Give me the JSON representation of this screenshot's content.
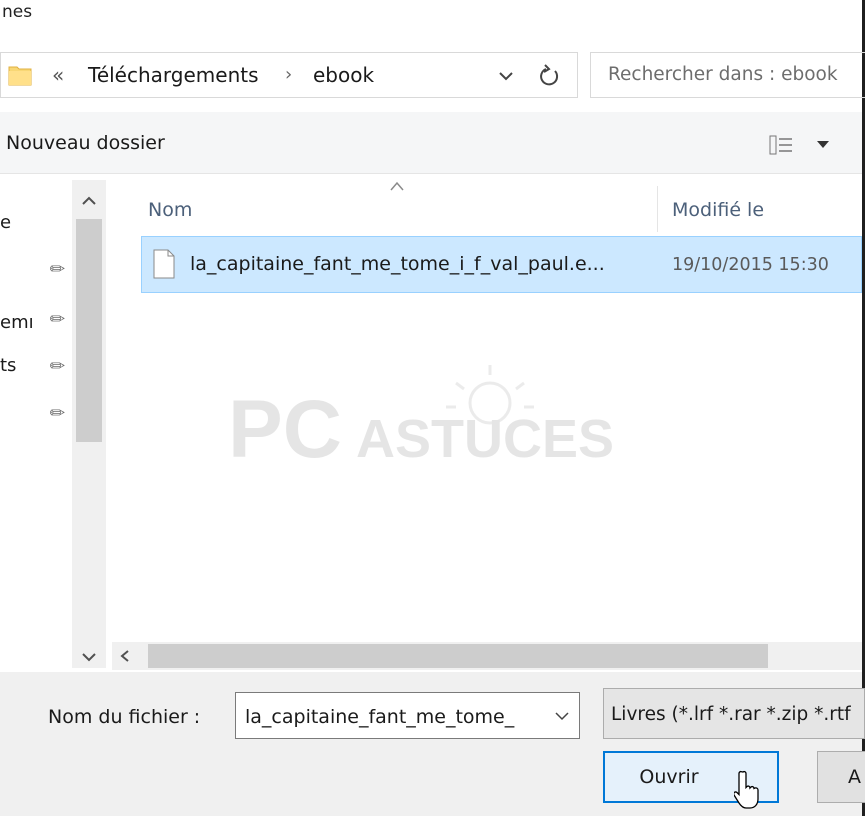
{
  "window": {
    "title_fragment": "nes"
  },
  "address_bar": {
    "overflow_chevron": "«",
    "breadcrumb": [
      "Téléchargements",
      "ebook"
    ],
    "separator": "›",
    "dropdown_icon": "chevron-down-icon",
    "refresh_icon": "refresh-icon"
  },
  "search": {
    "placeholder": "Rechercher dans : ebook"
  },
  "toolbar": {
    "new_folder_label": "Nouveau dossier"
  },
  "nav_pane": {
    "fragments": [
      "e",
      "",
      "emı",
      "ts",
      ""
    ],
    "pin_icon": "pin-icon"
  },
  "file_list": {
    "columns": {
      "name": "Nom",
      "modified": "Modifié le"
    },
    "rows": [
      {
        "name": "la_capitaine_fant_me_tome_i_f_val_paul.e...",
        "modified": "19/10/2015 15:30",
        "selected": true
      }
    ]
  },
  "watermark": {
    "text_left": "PC",
    "text_right": "ASTUCES"
  },
  "footer": {
    "filename_label": "Nom du fichier :",
    "filename_value": "la_capitaine_fant_me_tome_",
    "filetype_value": "Livres (*.lrf *.rar *.zip *.rtf",
    "open_button": "Ouvrir",
    "other_button": "A"
  },
  "colors": {
    "selection_bg": "#cce8ff",
    "selection_border": "#99d1ff",
    "header_text": "#4c607a",
    "accent": "#0078d7"
  }
}
